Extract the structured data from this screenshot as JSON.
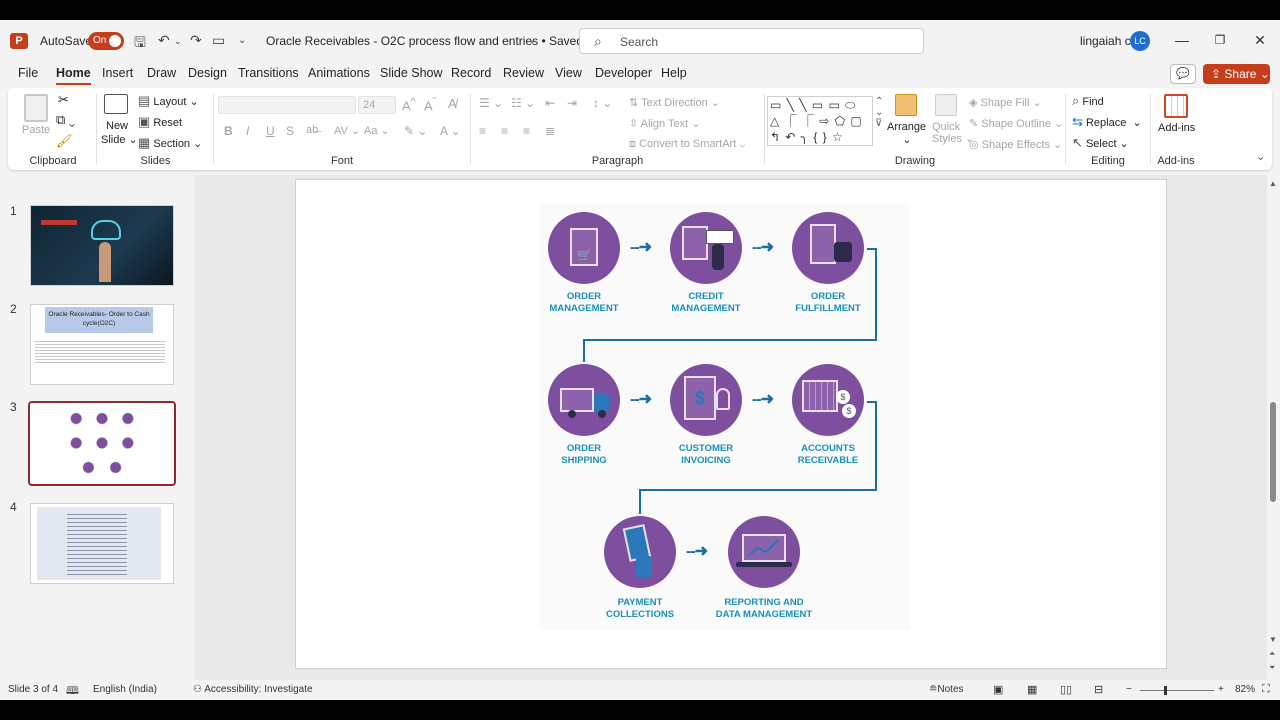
{
  "titlebar": {
    "autosave_label": "AutoSave",
    "autosave_state": "On",
    "doc_title": "Oracle Receivables - O2C process flow and entries • Saved",
    "search_placeholder": "Search",
    "user_name": "lingaiah c",
    "user_initials": "LC"
  },
  "menu": {
    "tabs": [
      "File",
      "Home",
      "Insert",
      "Draw",
      "Design",
      "Transitions",
      "Animations",
      "Slide Show",
      "Record",
      "Review",
      "View",
      "Developer",
      "Help"
    ],
    "active_tab": "Home",
    "share_label": "Share"
  },
  "ribbon": {
    "clipboard": {
      "paste": "Paste",
      "label": "Clipboard"
    },
    "slides": {
      "new_slide_1": "New",
      "new_slide_2": "Slide",
      "layout": "Layout",
      "reset": "Reset",
      "section": "Section",
      "label": "Slides"
    },
    "font": {
      "size": "24",
      "label": "Font"
    },
    "paragraph": {
      "text_direction": "Text Direction",
      "align_text": "Align Text",
      "convert_smartart": "Convert to SmartArt",
      "label": "Paragraph"
    },
    "drawing": {
      "arrange": "Arrange",
      "quick_styles_1": "Quick",
      "quick_styles_2": "Styles",
      "shape_fill": "Shape Fill",
      "shape_outline": "Shape Outline",
      "shape_effects": "Shape Effects",
      "label": "Drawing"
    },
    "editing": {
      "find": "Find",
      "replace": "Replace",
      "select": "Select",
      "label": "Editing"
    },
    "addins": {
      "addins": "Add-ins",
      "label": "Add-ins"
    }
  },
  "thumbnails": [
    {
      "num": "1"
    },
    {
      "num": "2",
      "title": "Oracle Receivables- Order to Cash cycle(O2C)"
    },
    {
      "num": "3"
    },
    {
      "num": "4"
    }
  ],
  "slide": {
    "steps": [
      {
        "line1": "ORDER",
        "line2": "MANAGEMENT"
      },
      {
        "line1": "CREDIT",
        "line2": "MANAGEMENT"
      },
      {
        "line1": "ORDER",
        "line2": "FULFILLMENT"
      },
      {
        "line1": "ORDER",
        "line2": "SHIPPING"
      },
      {
        "line1": "CUSTOMER",
        "line2": "INVOICING"
      },
      {
        "line1": "ACCOUNTS",
        "line2": "RECEIVABLE"
      },
      {
        "line1": "PAYMENT",
        "line2": "COLLECTIONS"
      },
      {
        "line1": "REPORTING AND",
        "line2": "DATA MANAGEMENT"
      }
    ],
    "colors": {
      "circle": "#7f4f9f",
      "label": "#1a8fb8",
      "connector": "#1a6fa0"
    }
  },
  "statusbar": {
    "slide_of": "Slide 3 of 4",
    "language": "English (India)",
    "accessibility": "Accessibility: Investigate",
    "notes": "Notes",
    "zoom": "82%"
  }
}
